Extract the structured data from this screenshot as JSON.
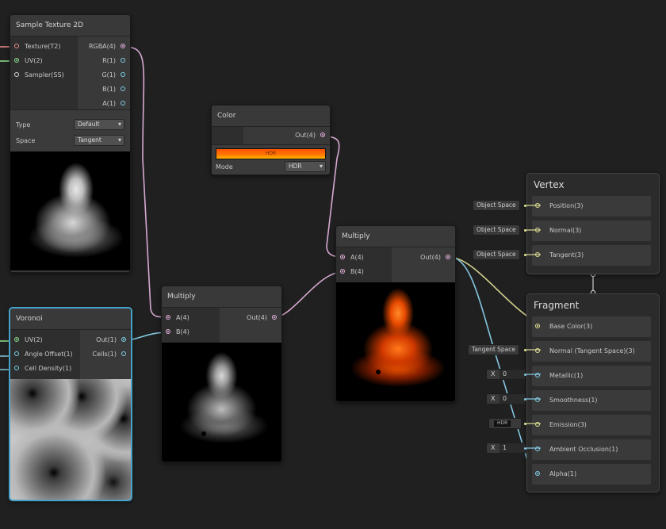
{
  "sample_texture": {
    "title": "Sample Texture 2D",
    "inputs": [
      "Texture(T2)",
      "UV(2)",
      "Sampler(SS)"
    ],
    "outputs": [
      "RGBA(4)",
      "R(1)",
      "G(1)",
      "B(1)",
      "A(1)"
    ],
    "type_label": "Type",
    "type_value": "Default",
    "space_label": "Space",
    "space_value": "Tangent"
  },
  "voronoi": {
    "title": "Voronoi",
    "inputs": [
      "UV(2)",
      "Angle Offset(1)",
      "Cell Density(1)"
    ],
    "outputs": [
      "Out(1)",
      "Cells(1)"
    ]
  },
  "multiply1": {
    "title": "Multiply",
    "inputs": [
      "A(4)",
      "B(4)"
    ],
    "outputs": [
      "Out(4)"
    ]
  },
  "color": {
    "title": "Color",
    "outputs": [
      "Out(4)"
    ],
    "hdr_label": "HDR",
    "mode_label": "Mode",
    "mode_value": "HDR",
    "swatch_color": "#ff5a00"
  },
  "multiply2": {
    "title": "Multiply",
    "inputs": [
      "A(4)",
      "B(4)"
    ],
    "outputs": [
      "Out(4)"
    ]
  },
  "vertex": {
    "title": "Vertex",
    "blocks": [
      "Position(3)",
      "Normal(3)",
      "Tangent(3)"
    ],
    "space_fields": [
      "Object Space",
      "Object Space",
      "Object Space"
    ]
  },
  "fragment": {
    "title": "Fragment",
    "blocks": [
      "Base Color(3)",
      "Normal (Tangent Space)(3)",
      "Metallic(1)",
      "Smoothness(1)",
      "Emission(3)",
      "Ambient Occlusion(1)",
      "Alpha(1)"
    ],
    "normal_space": "Tangent Space",
    "metallic": {
      "label": "X",
      "value": "0"
    },
    "smoothness": {
      "label": "X",
      "value": "0"
    },
    "emission_hdr": "HDR",
    "ambient_occlusion": {
      "label": "X",
      "value": "1"
    }
  },
  "colors": {
    "selection": "#45a3c7",
    "wire_vector4": "#d7a9d2",
    "wire_vector1": "#84c6e0",
    "wire_vector3": "#d3d38f",
    "wire_texture": "#f08a8a",
    "wire_uv": "#8fe38f"
  }
}
